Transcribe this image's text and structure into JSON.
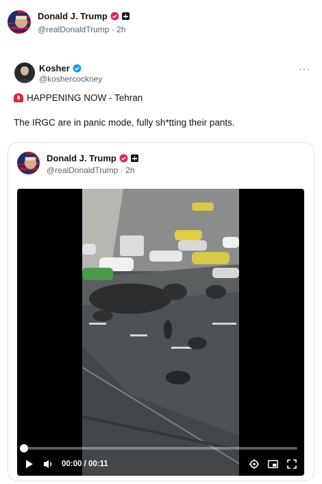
{
  "outer_post": {
    "author_name": "Donald J. Trump",
    "handle": "@realDonaldTrump",
    "separator": "·",
    "time": "2h"
  },
  "main_post": {
    "author_name": "Kosher",
    "handle": "@koshercockney",
    "more_label": "···",
    "line1": "HAPPENING NOW - Tehran",
    "line2": "The IRGC are in panic mode, fully sh*tting their pants."
  },
  "quoted_post": {
    "author_name": "Donald J. Trump",
    "handle": "@realDonaldTrump",
    "separator": "·",
    "time": "2h"
  },
  "video": {
    "current_time": "00:00",
    "duration": "00:11",
    "progress_fraction": 0.0
  },
  "icons": {
    "verified_gold": "verified-badge-pink",
    "verified_blue": "verified-badge-blue",
    "affiliation": "plus-box-icon"
  },
  "colors": {
    "verified_blue": "#1d9bf0",
    "verified_pink": "#e0245e",
    "secondary_text": "#536471"
  }
}
